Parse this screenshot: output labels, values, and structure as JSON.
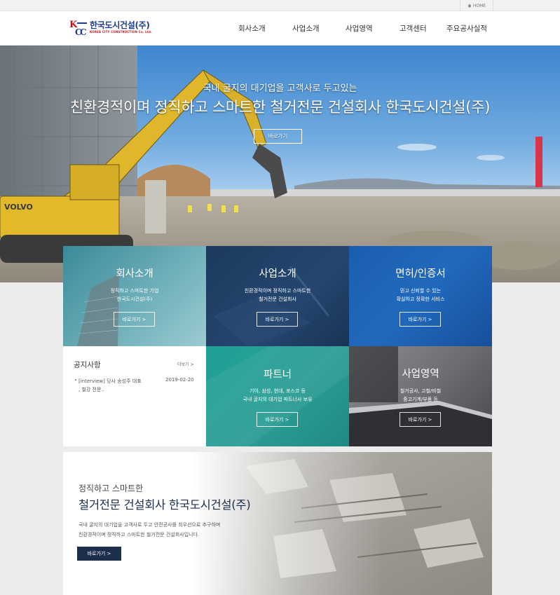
{
  "topbar": {
    "home_label": "HOME"
  },
  "logo": {
    "mark": "KCC",
    "name_ko": "한국도시건설(주)",
    "name_en": "KOREA CITY CONSTRUCTION Co. Ltd."
  },
  "nav": {
    "items": [
      "회사소개",
      "사업소개",
      "사업영역",
      "고객센터",
      "주요공사실적"
    ]
  },
  "hero": {
    "subtitle": "국내 굴지의 대기업을 고객사로 두고있는",
    "title": "친환경적이며 정직하고 스마트한 철거전문 건설회사 한국도시건설(주)",
    "button": "바로가기"
  },
  "tiles": [
    {
      "title": "회사소개",
      "desc1": "정직하고 스마트한 기업",
      "desc2": "한국도시건설(주)",
      "button": "바로가기 >"
    },
    {
      "title": "사업소개",
      "desc1": "친환경적이며 정직하고 스마트한",
      "desc2": "철거전문 건설회사",
      "button": "바로가기 >"
    },
    {
      "title": "면허/인증서",
      "desc1": "믿고 신뢰할 수 있는",
      "desc2": "확실하고 정확한 서비스",
      "button": "바로가기 >"
    },
    {
      "title": "파트너",
      "desc1": "기아, 삼성, 현대, 포스코 등",
      "desc2": "국내 굴지의 대기업 파트너사 보유",
      "button": "바로가기 >"
    },
    {
      "title": "사업영역",
      "desc1": "철거공사, 고철/비철",
      "desc2": "중고기계/부품 등",
      "button": "바로가기 >"
    }
  ],
  "notice": {
    "title": "공지사항",
    "more": "더보기 >",
    "items": [
      {
        "text": "[interview] 당사 송성주 대표 , 철강 전문..",
        "date": "2019-02-20"
      }
    ]
  },
  "about": {
    "subtitle": "정직하고 스마트한",
    "title": "철거전문 건설회사 한국도시건설(주)",
    "desc1": "국내 굴지의 대기업을 고객사로 두고 안전공사를 최우선으로 추구하며",
    "desc2": "친환경적이며 정직하고 스마트한 철거전문 건설회사입니다.",
    "button": "바로가기 >"
  },
  "colors": {
    "brand_navy": "#1d2d4c",
    "logo_blue": "#1c3c8c",
    "logo_red": "#c4121a",
    "tile_teal": "#2a9d94",
    "tile_blue": "#1f5ea8"
  }
}
